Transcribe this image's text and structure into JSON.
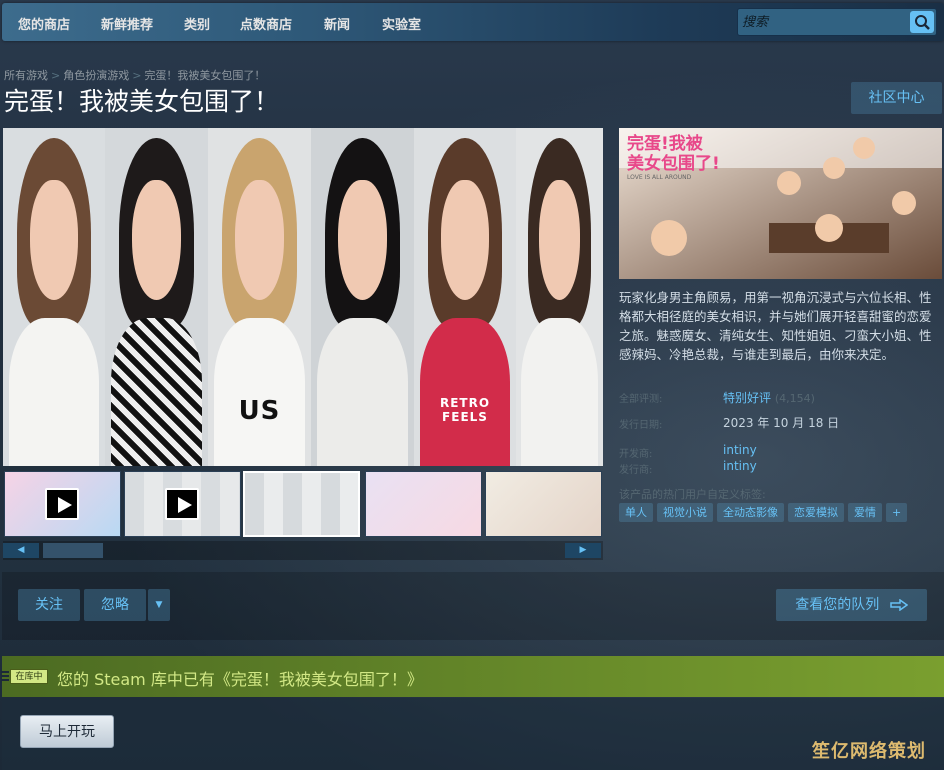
{
  "nav": {
    "items": [
      "您的商店",
      "新鲜推荐",
      "类别",
      "点数商店",
      "新闻",
      "实验室"
    ],
    "search_placeholder": "搜索"
  },
  "breadcrumb": [
    "所有游戏",
    "角色扮演游戏",
    "完蛋！我被美女包围了！"
  ],
  "game": {
    "title": "完蛋！我被美女包围了！",
    "community_button": "社区中心",
    "capsule_logo_line1": "完蛋!我被",
    "capsule_logo_line2": "美女包围了!",
    "capsule_logo_sub": "LOVE IS ALL AROUND",
    "description": "玩家化身男主角顾易，用第一视角沉浸式与六位长相、性格都大相径庭的美女相识，并与她们展开轻喜甜蜜的恋爱之旅。魅惑魔女、清纯女生、知性姐姐、刁蛮大小姐、性感辣妈、冷艳总裁，与谁走到最后，由你来决定。",
    "reviews_label": "全部评测:",
    "reviews_value": "特别好评",
    "reviews_count": "(4,154)",
    "release_label": "发行日期:",
    "release_value": "2023 年 10 月 18 日",
    "developer_label": "开发商:",
    "developer_value": "intiny",
    "publisher_label": "发行商:",
    "publisher_value": "intiny",
    "tags_title": "该产品的热门用户自定义标签:",
    "tags": [
      "单人",
      "视觉小说",
      "全动态影像",
      "恋爱模拟",
      "爱情",
      "+"
    ]
  },
  "media": {
    "shirt_texts": [
      "US",
      "RETRO FEELS"
    ],
    "slider_left": "◀",
    "slider_right": "▶"
  },
  "actions": {
    "follow": "关注",
    "ignore": "忽略",
    "dropdown": "▼",
    "queue": "查看您的队列"
  },
  "library": {
    "badge": "在库中",
    "text": "您的 Steam 库中已有《完蛋！我被美女包围了！》",
    "play_now": "马上开玩"
  },
  "watermark": "笙亿网络策划",
  "colors": {
    "accent": "#66c0f4",
    "nav_bg": "#2f5a7a",
    "library_green": "#7a9f2f",
    "page_bg": "#1b2838"
  }
}
